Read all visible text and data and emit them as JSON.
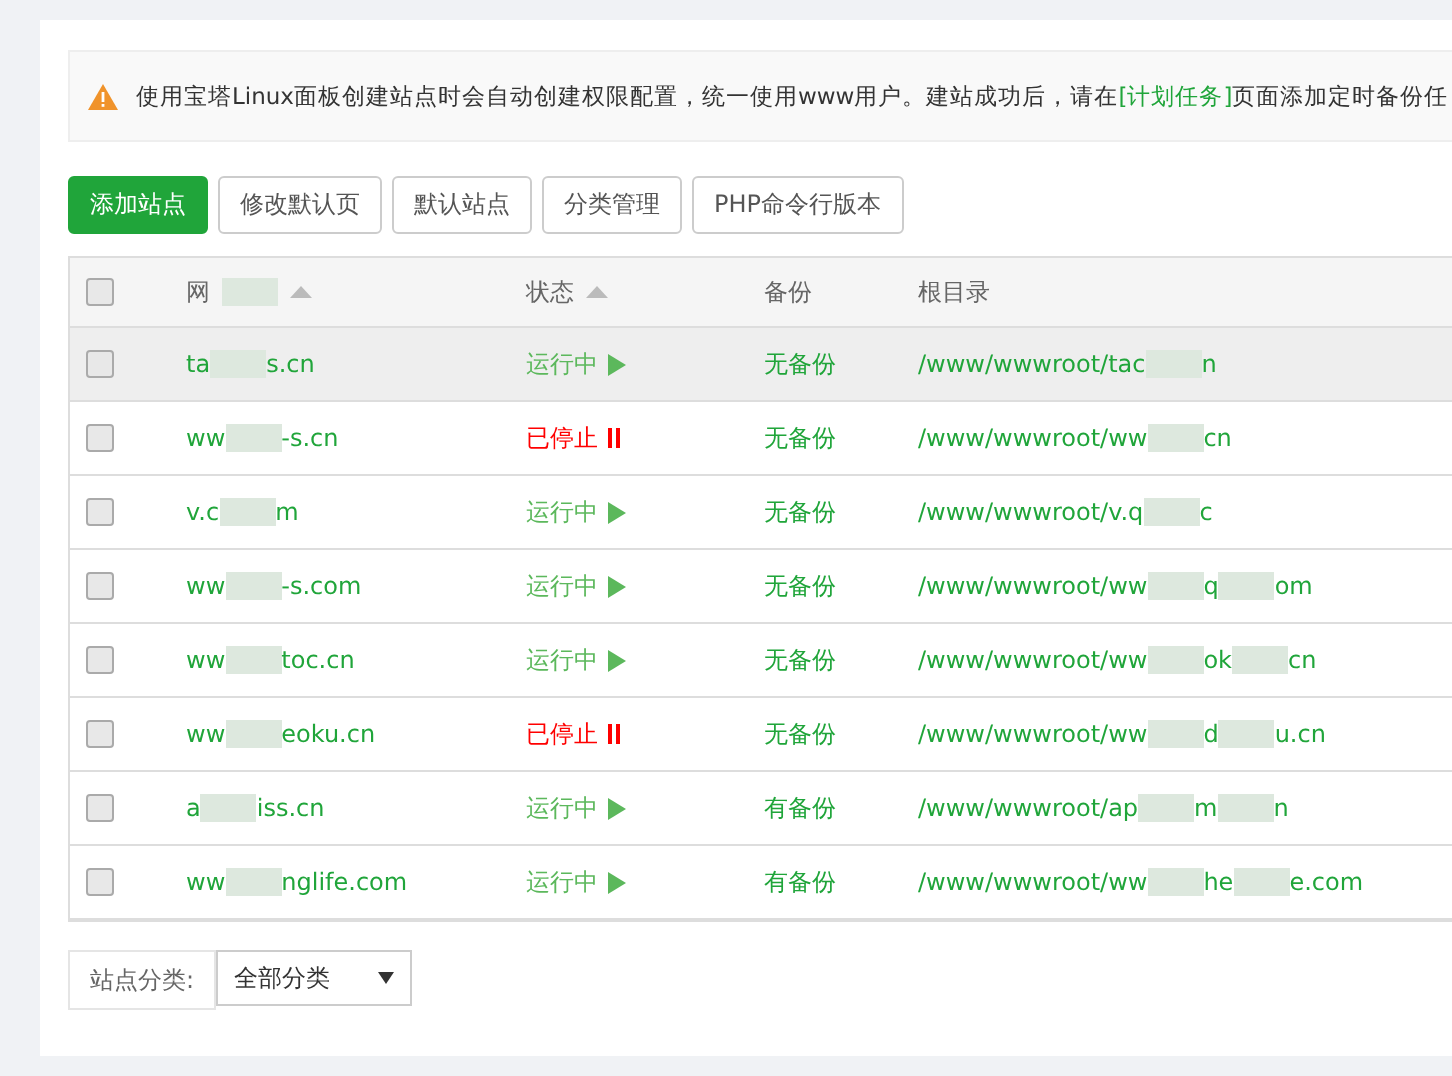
{
  "notice": {
    "parts": [
      "使用宝塔Linux面板创建站点时会自动创建权限配置，统一使用www用户。建站成功后，请在",
      "[计划任务]",
      "页面添加定时备份任"
    ]
  },
  "buttons": [
    {
      "label": "添加站点",
      "primary": true
    },
    {
      "label": "修改默认页",
      "primary": false
    },
    {
      "label": "默认站点",
      "primary": false
    },
    {
      "label": "分类管理",
      "primary": false
    },
    {
      "label": "PHP命令行版本",
      "primary": false
    }
  ],
  "table": {
    "select_all": {
      "checked": false
    },
    "columns": [
      {
        "label": "网",
        "kind": "redacted_sortable"
      },
      {
        "label": "状态",
        "kind": "sortable"
      },
      {
        "label": "备份",
        "kind": "plain"
      },
      {
        "label": "根目录",
        "kind": "plain"
      }
    ],
    "rows": [
      {
        "checked": false,
        "highlighted": true,
        "site": [
          "ta",
          "s.cn"
        ],
        "status": {
          "kind": "running",
          "label": "运行中"
        },
        "backup": "无备份",
        "root": [
          "/www/wwwroot/tac",
          "n"
        ]
      },
      {
        "checked": false,
        "highlighted": false,
        "site": [
          "ww",
          "-s.cn"
        ],
        "status": {
          "kind": "stopped",
          "label": "已停止"
        },
        "backup": "无备份",
        "root": [
          "/www/wwwroot/ww",
          "cn"
        ]
      },
      {
        "checked": false,
        "highlighted": false,
        "site": [
          "v.c",
          "m"
        ],
        "status": {
          "kind": "running",
          "label": "运行中"
        },
        "backup": "无备份",
        "root": [
          "/www/wwwroot/v.q",
          "c"
        ]
      },
      {
        "checked": false,
        "highlighted": false,
        "site": [
          "ww",
          "-s.com"
        ],
        "status": {
          "kind": "running",
          "label": "运行中"
        },
        "backup": "无备份",
        "root": [
          "/www/wwwroot/ww",
          "q",
          "om"
        ]
      },
      {
        "checked": false,
        "highlighted": false,
        "site": [
          "ww",
          "toc.cn"
        ],
        "status": {
          "kind": "running",
          "label": "运行中"
        },
        "backup": "无备份",
        "root": [
          "/www/wwwroot/ww",
          "ok",
          "cn"
        ]
      },
      {
        "checked": false,
        "highlighted": false,
        "site": [
          "ww",
          "eoku.cn"
        ],
        "status": {
          "kind": "stopped",
          "label": "已停止"
        },
        "backup": "无备份",
        "root": [
          "/www/wwwroot/ww",
          "d",
          "u.cn"
        ]
      },
      {
        "checked": false,
        "highlighted": false,
        "site": [
          "a",
          "iss.cn"
        ],
        "status": {
          "kind": "running",
          "label": "运行中"
        },
        "backup": "有备份",
        "root": [
          "/www/wwwroot/ap",
          "m",
          "n"
        ]
      },
      {
        "checked": false,
        "highlighted": false,
        "site": [
          "ww",
          "nglife.com"
        ],
        "status": {
          "kind": "running",
          "label": "运行中"
        },
        "backup": "有备份",
        "root": [
          "/www/wwwroot/ww",
          "he",
          "e.com"
        ]
      }
    ]
  },
  "category_filter": {
    "label": "站点分类:",
    "value": "全部分类"
  }
}
